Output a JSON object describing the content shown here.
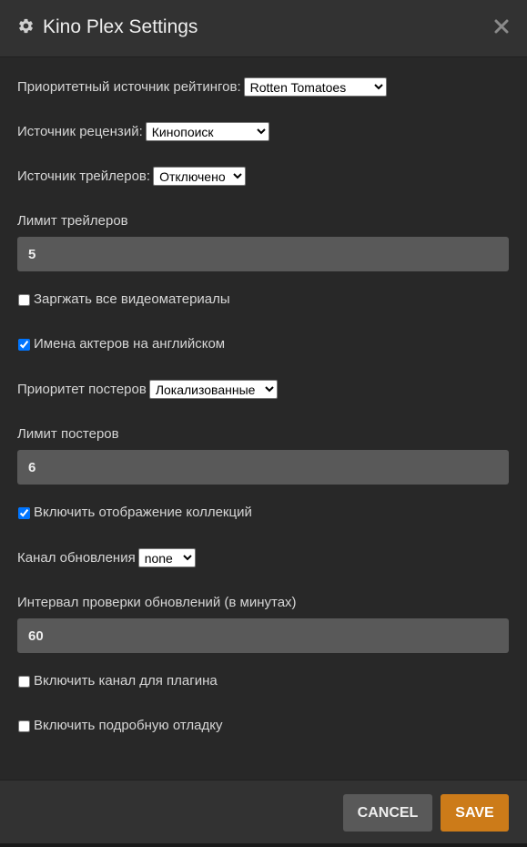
{
  "header": {
    "title": "Kino Plex Settings",
    "icon": "gear-icon",
    "close_icon": "close-icon"
  },
  "settings": {
    "rating_source": {
      "label": "Приоритетный источник рейтингов:",
      "selected": "Rotten Tomatoes"
    },
    "review_source": {
      "label": "Источник рецензий:",
      "selected": "Кинопоиск"
    },
    "trailer_source": {
      "label": "Источник трейлеров:",
      "selected": "Отключено"
    },
    "trailer_limit": {
      "label": "Лимит трейлеров",
      "value": "5"
    },
    "load_all_video": {
      "label": "Заргжать все видеоматериалы",
      "checked": false
    },
    "actor_names_english": {
      "label": "Имена актеров на английском",
      "checked": true
    },
    "poster_priority": {
      "label": "Приоритет постеров",
      "selected": "Локализованные"
    },
    "poster_limit": {
      "label": "Лимит постеров",
      "value": "6"
    },
    "enable_collections": {
      "label": "Включить отображение коллекций",
      "checked": true
    },
    "update_channel": {
      "label": "Канал обновления",
      "selected": "none"
    },
    "update_interval": {
      "label": "Интервал проверки обновлений (в минутах)",
      "value": "60"
    },
    "enable_plugin_channel": {
      "label": "Включить канал для плагина",
      "checked": false
    },
    "enable_debug": {
      "label": "Включить подробную отладку",
      "checked": false
    }
  },
  "footer": {
    "cancel_label": "CANCEL",
    "save_label": "SAVE"
  },
  "colors": {
    "background": "#282828",
    "header": "#323232",
    "input": "#595959",
    "save_button": "#cc7b19",
    "cancel_button": "#595959"
  }
}
